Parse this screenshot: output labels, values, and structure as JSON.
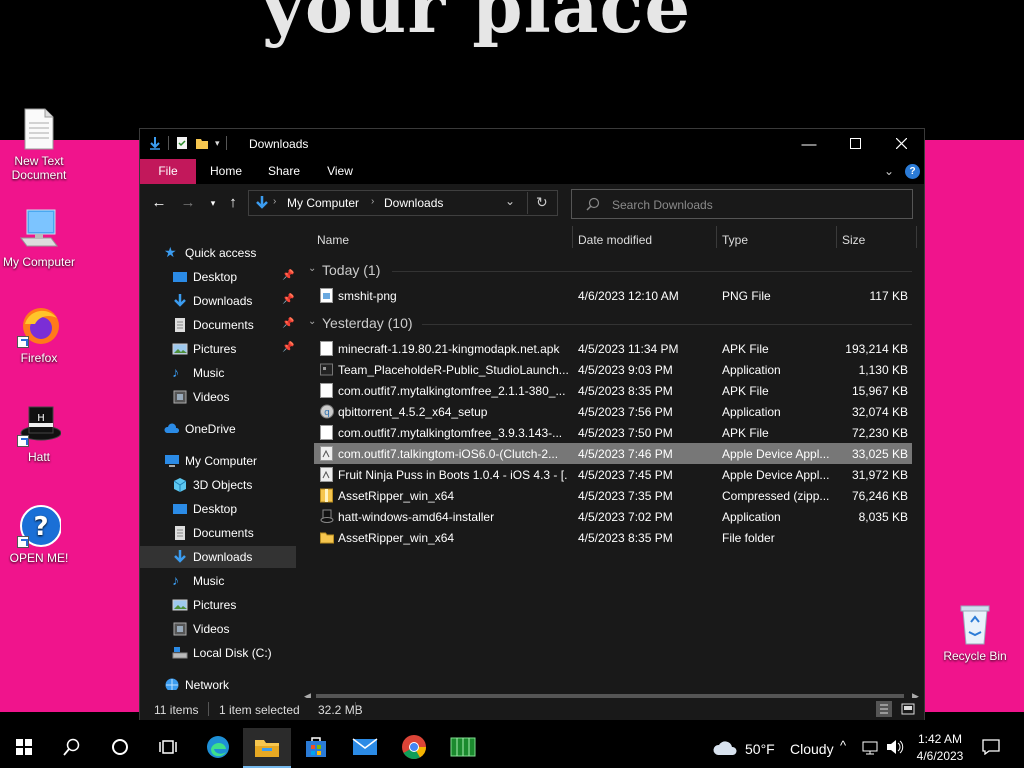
{
  "wallpaper": {
    "text": "your place"
  },
  "desktop_icons": [
    {
      "label": "New Text Document"
    },
    {
      "label": "My Computer"
    },
    {
      "label": "Firefox"
    },
    {
      "label": "Hatt"
    },
    {
      "label": "OPEN ME!"
    },
    {
      "label": "Recycle Bin"
    }
  ],
  "window": {
    "title": "Downloads",
    "ribbon_tabs": [
      "File",
      "Home",
      "Share",
      "View"
    ],
    "address": {
      "crumbs": [
        "My Computer",
        "Downloads"
      ]
    },
    "search": {
      "placeholder": "Search Downloads"
    },
    "nav": {
      "quick_access": "Quick access",
      "quick_items": [
        "Desktop",
        "Downloads",
        "Documents",
        "Pictures",
        "Music",
        "Videos"
      ],
      "onedrive": "OneDrive",
      "my_computer": "My Computer",
      "pc_items": [
        "3D Objects",
        "Desktop",
        "Documents",
        "Downloads",
        "Music",
        "Pictures",
        "Videos",
        "Local Disk (C:)"
      ],
      "network": "Network"
    },
    "columns": [
      "Name",
      "Date modified",
      "Type",
      "Size"
    ],
    "groups": [
      {
        "label": "Today (1)"
      },
      {
        "label": "Yesterday (10)"
      }
    ],
    "files": [
      {
        "name": "smshit-png",
        "date": "4/6/2023 12:10 AM",
        "type": "PNG File",
        "size": "117 KB"
      },
      {
        "name": "minecraft-1.19.80.21-kingmodapk.net.apk",
        "date": "4/5/2023 11:34 PM",
        "type": "APK File",
        "size": "193,214 KB"
      },
      {
        "name": "Team_PlaceholdeR-Public_StudioLaunch...",
        "date": "4/5/2023 9:03 PM",
        "type": "Application",
        "size": "1,130 KB"
      },
      {
        "name": "com.outfit7.mytalkingtomfree_2.1.1-380_...",
        "date": "4/5/2023 8:35 PM",
        "type": "APK File",
        "size": "15,967 KB"
      },
      {
        "name": "qbittorrent_4.5.2_x64_setup",
        "date": "4/5/2023 7:56 PM",
        "type": "Application",
        "size": "32,074 KB"
      },
      {
        "name": "com.outfit7.mytalkingtomfree_3.9.3.143-...",
        "date": "4/5/2023 7:50 PM",
        "type": "APK File",
        "size": "72,230 KB"
      },
      {
        "name": "com.outfit7.talkingtom-iOS6.0-(Clutch-2...",
        "date": "4/5/2023 7:46 PM",
        "type": "Apple Device Appl...",
        "size": "33,025 KB"
      },
      {
        "name": "Fruit Ninja Puss in Boots 1.0.4 - iOS 4.3 - [...",
        "date": "4/5/2023 7:45 PM",
        "type": "Apple Device Appl...",
        "size": "31,972 KB"
      },
      {
        "name": "AssetRipper_win_x64",
        "date": "4/5/2023 7:35 PM",
        "type": "Compressed (zipp...",
        "size": "76,246 KB"
      },
      {
        "name": "hatt-windows-amd64-installer",
        "date": "4/5/2023 7:02 PM",
        "type": "Application",
        "size": "8,035 KB"
      },
      {
        "name": "AssetRipper_win_x64",
        "date": "4/5/2023 8:35 PM",
        "type": "File folder",
        "size": ""
      }
    ],
    "status": {
      "items": "11 items",
      "selected": "1 item selected",
      "size": "32.2 MB"
    }
  },
  "taskbar": {
    "weather_temp": "50°F",
    "weather_text": "Cloudy",
    "time": "1:42 AM",
    "date": "4/6/2023"
  },
  "colors": {
    "accent": "#c2185b",
    "wallpaper": "#f0148c",
    "selection": "#777777"
  }
}
